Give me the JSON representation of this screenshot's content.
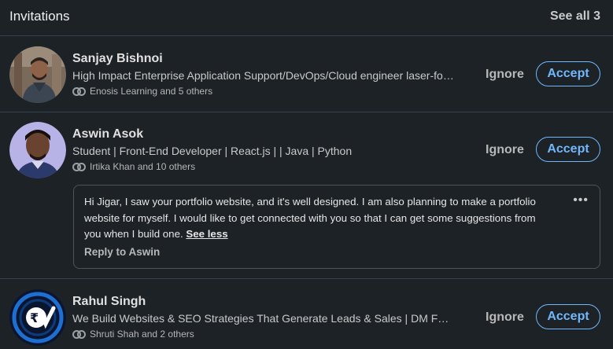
{
  "header": {
    "title": "Invitations",
    "see_all": "See all 3"
  },
  "invitations": [
    {
      "name": "Sanjay Bishnoi",
      "headline": "High Impact Enterprise Application Support/DevOps/Cloud engineer laser-focused on delivering measurable results",
      "mutual": "Enosis Learning and 5 others",
      "ignore": "Ignore",
      "accept": "Accept"
    },
    {
      "name": "Aswin Asok",
      "headline": "Student | Front-End Developer | React.js | | Java | Python",
      "mutual": "Irtika Khan and 10 others",
      "ignore": "Ignore",
      "accept": "Accept",
      "message": {
        "text": "Hi Jigar, I saw your portfolio website, and it's well designed. I am also planning to make a portfolio website for myself. I would like to get connected with you so that I can get some suggestions from you when I build one.",
        "see_less": "See less",
        "reply": "Reply to Aswin",
        "more": "•••"
      }
    },
    {
      "name": "Rahul Singh",
      "headline": "We Build Websites & SEO Strategies That Generate Leads & Sales | DM For A Free Consultation",
      "mutual": "Shruti Shah and 2 others",
      "ignore": "Ignore",
      "accept": "Accept"
    }
  ],
  "colors": {
    "accent": "#71b7fb",
    "background": "#1d2226",
    "divider": "#38434f"
  }
}
